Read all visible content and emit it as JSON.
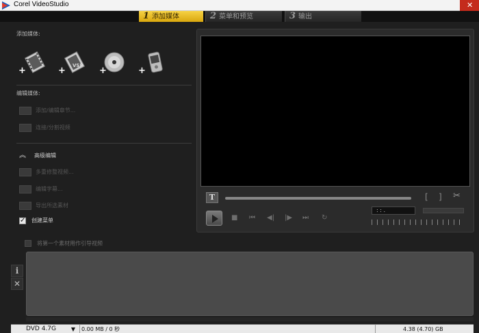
{
  "window": {
    "title": "Corel VideoStudio",
    "close_glyph": "✕"
  },
  "steps": [
    {
      "num": "1",
      "label": "添加媒体"
    },
    {
      "num": "2",
      "label": "菜单和预览"
    },
    {
      "num": "3",
      "label": "输出"
    }
  ],
  "left": {
    "add_media_heading": "添加媒体:",
    "add_media_icons": [
      "add-video-icon",
      "add-vsp-project-icon",
      "add-disc-icon",
      "add-mobile-device-icon"
    ],
    "vsp_text": "VSP",
    "edit_media_heading": "编辑媒体:",
    "edit_items": [
      "添加/编辑章节...",
      "连接/分割视频"
    ],
    "advanced_label": "高级编辑",
    "advanced_items": [
      "多重修整视频...",
      "编辑字幕...",
      "导出所选素材"
    ],
    "create_menu_label": "创建菜单",
    "first_clip_label": "将第一个素材用作引导视频"
  },
  "preview": {
    "t_glyph": "T",
    "bracket_in": "[",
    "bracket_out": "]",
    "scissors_glyph": "✂",
    "timecode": " :  :   .",
    "controls": [
      "■",
      "⏮",
      "◀|",
      "|▶",
      "⏭",
      "↻"
    ]
  },
  "side": {
    "info_glyph": "i",
    "delete_glyph": "✕"
  },
  "status": {
    "disc_type": "DVD 4.7G",
    "used": "0.00 MB / 0 秒",
    "free": "4.38 (4.70) GB"
  }
}
